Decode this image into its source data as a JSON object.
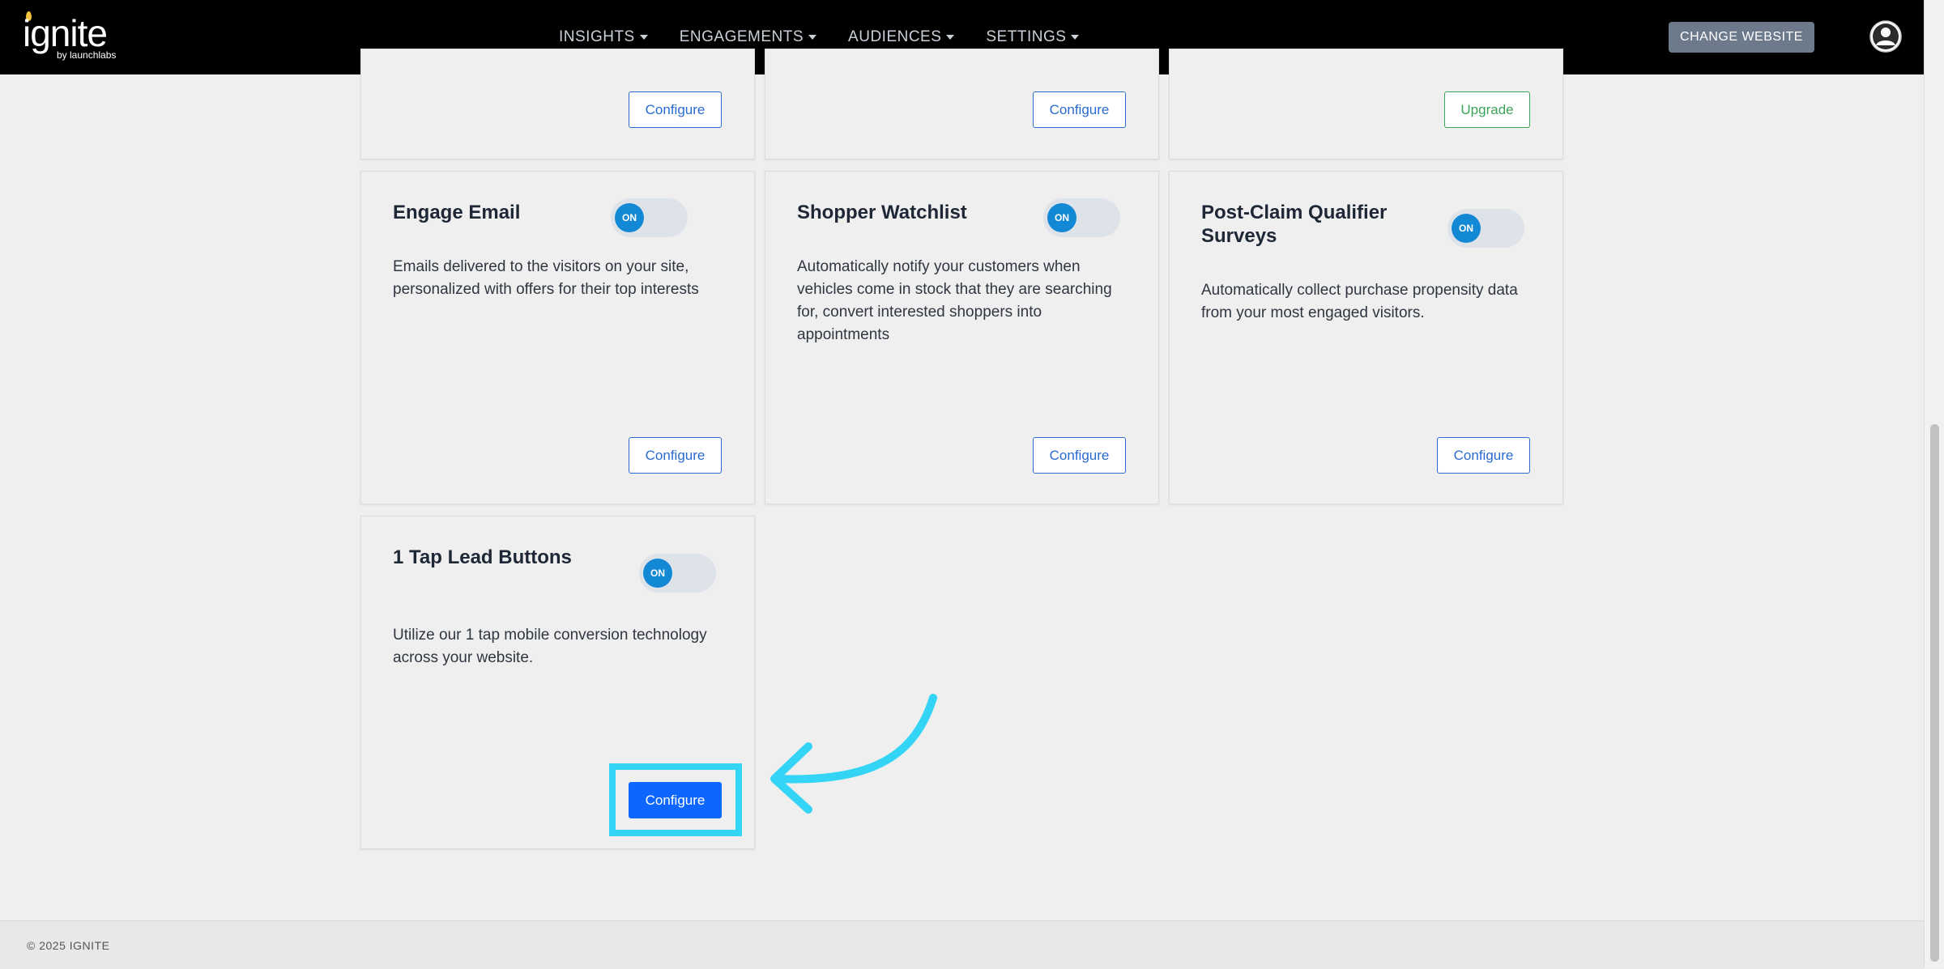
{
  "app": {
    "logo_text": "ignite",
    "logo_sub": "by launchlabs"
  },
  "nav": {
    "items": [
      {
        "label": "INSIGHTS"
      },
      {
        "label": "ENGAGEMENTS"
      },
      {
        "label": "AUDIENCES"
      },
      {
        "label": "SETTINGS"
      }
    ],
    "change_website": "CHANGE WEBSITE"
  },
  "top_row": {
    "buttons": [
      "Configure",
      "Configure",
      "Upgrade"
    ]
  },
  "cards": [
    {
      "title": "Engage Email",
      "toggle": "ON",
      "description": "Emails delivered to the visitors on your site, personalized with offers for their top interests",
      "button": "Configure"
    },
    {
      "title": "Shopper Watchlist",
      "toggle": "ON",
      "description": "Automatically notify your customers when vehicles come in stock that they are searching for, convert interested shoppers into appointments",
      "button": "Configure"
    },
    {
      "title": "Post-Claim Qualifier Surveys",
      "toggle": "ON",
      "description": "Automatically collect purchase propensity data from your most engaged visitors.",
      "button": "Configure"
    },
    {
      "title": "1 Tap Lead Buttons",
      "toggle": "ON",
      "description": "Utilize our 1 tap mobile conversion technology across your website.",
      "button": "Configure"
    }
  ],
  "footer": {
    "text": "© 2025 IGNITE"
  },
  "colors": {
    "accent": "#0d66ff",
    "highlight": "#33d4f5",
    "toggle_on": "#1389d6",
    "upgrade": "#3ba35a"
  }
}
